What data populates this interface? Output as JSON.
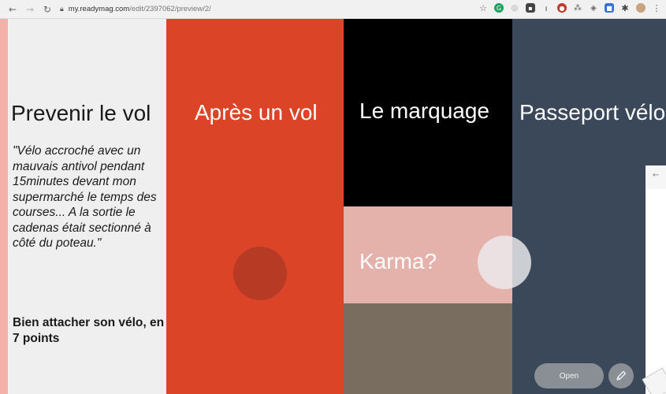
{
  "browser": {
    "url_host": "my.readymag.com",
    "url_path": "/edit/2397062/preview/2/"
  },
  "columns": [
    {
      "title": "Prevenir le vol",
      "quote": "\"Vélo accroché avec un mauvais antivol pendant 15minutes devant mon supermarché le temps des courses... A la sortie le cadenas était sectionné à côté du poteau.\"",
      "subhead": "Bien attacher son vélo, en 7 points"
    },
    {
      "title": "Après un vol"
    },
    {
      "title": "Le marquage",
      "secondary_title": "Karma?"
    },
    {
      "title": "Passeport vélo"
    }
  ],
  "controls": {
    "open_label": "Open",
    "pencil_icon": "pencil-icon",
    "back_icon": "arrow-left-icon"
  },
  "colors": {
    "col1": "#efefef",
    "col2": "#dc4428",
    "col3_top": "#000000",
    "col3_mid": "#e5b1ab",
    "col3_bot": "#786d5f",
    "col4": "#3b4859",
    "background": "#f3b1aa"
  }
}
